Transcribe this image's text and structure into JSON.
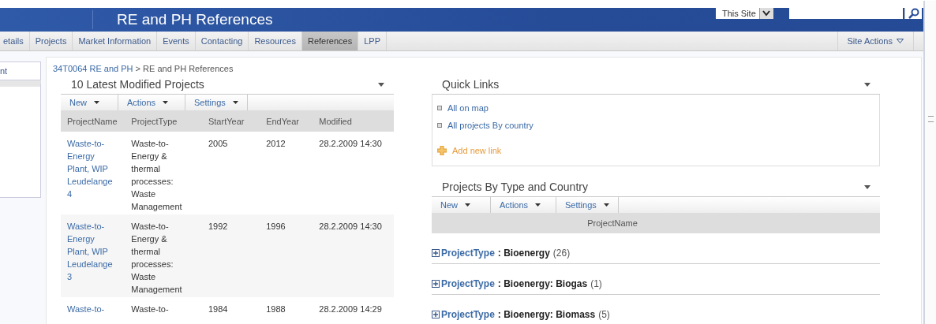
{
  "header": {
    "title": "RE and PH References",
    "scope": "This Site"
  },
  "nav": {
    "tabs": [
      {
        "label": "etails",
        "selected": false
      },
      {
        "label": "Projects",
        "selected": false
      },
      {
        "label": "Market Information",
        "selected": false
      },
      {
        "label": "Events",
        "selected": false
      },
      {
        "label": "Contacting",
        "selected": false
      },
      {
        "label": "Resources",
        "selected": false
      },
      {
        "label": "References",
        "selected": true
      },
      {
        "label": "LPP",
        "selected": false
      }
    ],
    "site_actions": "Site Actions"
  },
  "sidebar": {
    "items": [
      "nt"
    ]
  },
  "breadcrumb": {
    "parent": "34T0064 RE and PH",
    "separator": ">",
    "current": "RE and PH References"
  },
  "latest": {
    "title": "10 Latest Modified Projects",
    "toolbar": [
      "New",
      "Actions",
      "Settings"
    ],
    "columns": [
      "ProjectName",
      "ProjectType",
      "StartYear",
      "EndYear",
      "Modified"
    ],
    "rows": [
      {
        "name": "Waste-to-Energy Plant, WIP Leudelange 4",
        "type": "Waste-to-Energy & thermal processes: Waste Management",
        "start": "2005",
        "end": "2012",
        "modified": "28.2.2009 14:30"
      },
      {
        "name": "Waste-to-Energy Plant, WIP Leudelange 3",
        "type": "Waste-to-Energy & thermal processes: Waste Management",
        "start": "1992",
        "end": "1996",
        "modified": "28.2.2009 14:30"
      },
      {
        "name": "Waste-to-",
        "type": "Waste-to-",
        "start": "1984",
        "end": "1988",
        "modified": "28.2.2009 14:29"
      }
    ]
  },
  "quick_links": {
    "title": "Quick Links",
    "links": [
      "All on map",
      "All projects By country"
    ],
    "add": "Add new link"
  },
  "by_type": {
    "title": "Projects By Type and Country",
    "toolbar": [
      "New",
      "Actions",
      "Settings"
    ],
    "column": "ProjectName",
    "groups": [
      {
        "field": "ProjectType",
        "value": ": Bioenergy",
        "count": "(26)"
      },
      {
        "field": "ProjectType",
        "value": ": Bioenergy: Biogas",
        "count": "(1)"
      },
      {
        "field": "ProjectType",
        "value": ": Bioenergy: Biomass",
        "count": "(5)"
      }
    ]
  }
}
